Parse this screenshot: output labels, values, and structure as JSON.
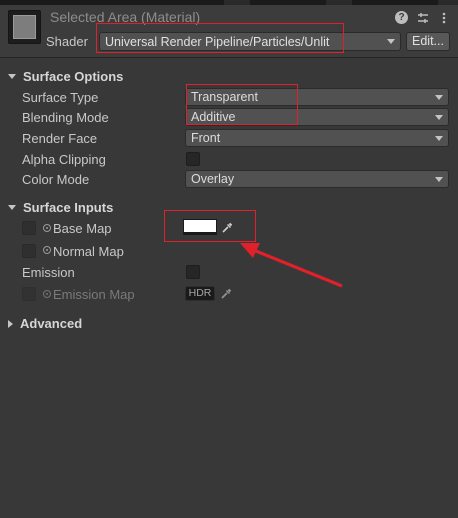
{
  "header": {
    "title": "Selected Area (Material)",
    "shader_label": "Shader",
    "shader_value": "Universal Render Pipeline/Particles/Unlit",
    "edit_label": "Edit...",
    "icons": [
      "help-icon",
      "settings-sliders-icon",
      "more-icon"
    ]
  },
  "surface_options": {
    "title": "Surface Options",
    "props": [
      {
        "label": "Surface Type",
        "value": "Transparent"
      },
      {
        "label": "Blending Mode",
        "value": "Additive"
      },
      {
        "label": "Render Face",
        "value": "Front"
      },
      {
        "label": "Alpha Clipping",
        "value": false
      },
      {
        "label": "Color Mode",
        "value": "Overlay"
      }
    ]
  },
  "surface_inputs": {
    "title": "Surface Inputs",
    "base_map_label": "Base Map",
    "base_map_color": "#ffffff",
    "normal_map_label": "Normal Map",
    "emission_label": "Emission",
    "emission_map_label": "Emission Map",
    "hdr_label": "HDR"
  },
  "advanced": {
    "title": "Advanced"
  },
  "colors": {
    "annotation": "#e0202a"
  }
}
